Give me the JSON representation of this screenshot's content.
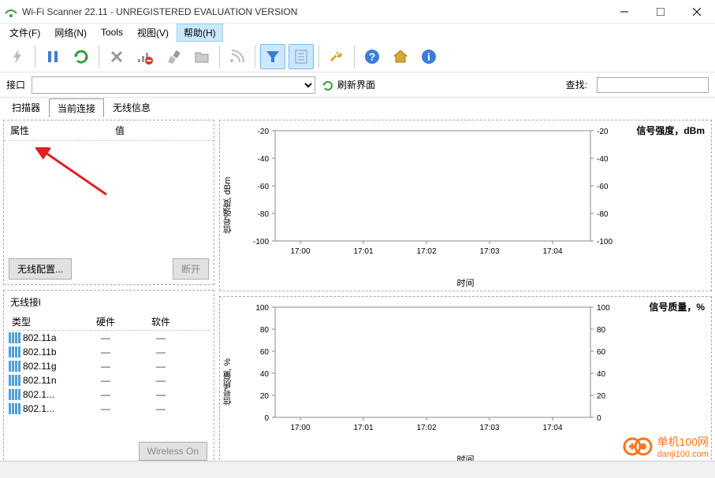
{
  "window": {
    "title": "Wi-Fi Scanner 22.11 - UNREGISTERED EVALUATION VERSION"
  },
  "menu": {
    "file": "文件(F)",
    "network": "网络(N)",
    "tools": "Tools",
    "view": "视图(V)",
    "help": "帮助(H)"
  },
  "interface": {
    "label": "接口",
    "refresh": "刷新界面",
    "search_label": "查找:",
    "search_value": ""
  },
  "tabs": {
    "scanner": "扫描器",
    "current": "当前连接",
    "wireless_info": "无线信息"
  },
  "props": {
    "attr": "属性",
    "value": "值",
    "config_btn": "无线配置...",
    "disconnect_btn": "断开"
  },
  "wireless": {
    "title": "无线接l",
    "col_type": "类型",
    "col_hw": "硬件",
    "col_sw": "软件",
    "rows": [
      {
        "type": "802.11a",
        "hw": "—",
        "sw": "—"
      },
      {
        "type": "802.11b",
        "hw": "—",
        "sw": "—"
      },
      {
        "type": "802.11g",
        "hw": "—",
        "sw": "—"
      },
      {
        "type": "802.11n",
        "hw": "—",
        "sw": "—"
      },
      {
        "type": "802.1...",
        "hw": "—",
        "sw": "—"
      },
      {
        "type": "802.1...",
        "hw": "—",
        "sw": "—"
      }
    ],
    "footer_btn": "Wireless On"
  },
  "chart_data": [
    {
      "type": "line",
      "title": "信号强度，dBm",
      "ylabel": "信号强度, dBm",
      "xlabel": "时间",
      "ylim": [
        -100,
        -20
      ],
      "yticks": [
        -20,
        -40,
        -60,
        -80,
        -100
      ],
      "categories": [
        "17:00",
        "17:01",
        "17:02",
        "17:03",
        "17:04"
      ],
      "series": []
    },
    {
      "type": "line",
      "title": "信号质量，%",
      "ylabel": "信号质量, %",
      "xlabel": "时间",
      "ylim": [
        0,
        100
      ],
      "yticks": [
        100,
        80,
        60,
        40,
        20,
        0
      ],
      "categories": [
        "17:00",
        "17:01",
        "17:02",
        "17:03",
        "17:04"
      ],
      "series": []
    }
  ],
  "watermark": {
    "name": "单机100网",
    "domain": "danji100.com"
  }
}
